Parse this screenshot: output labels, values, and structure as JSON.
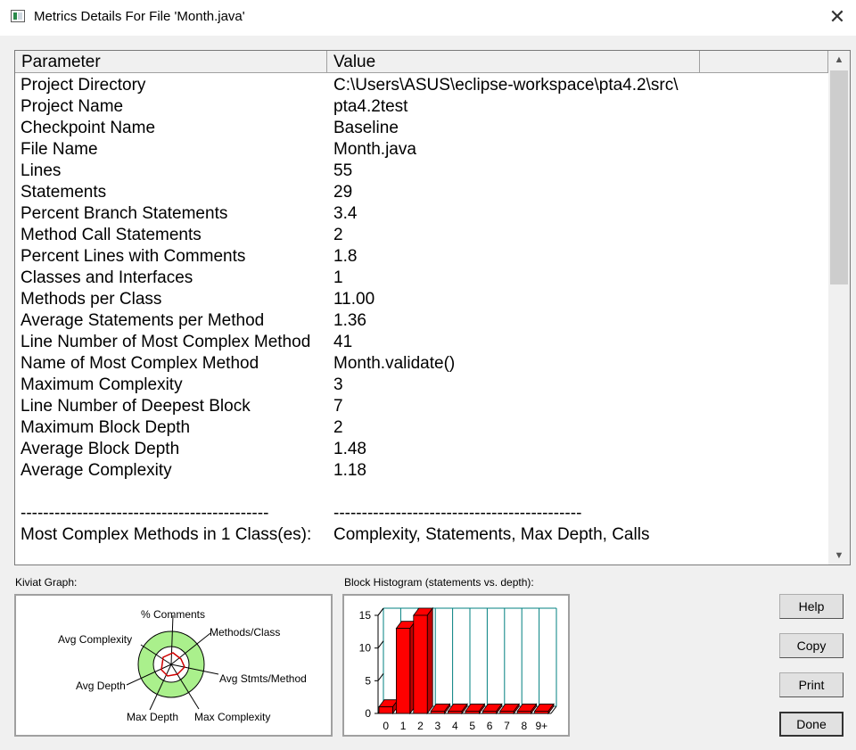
{
  "window": {
    "title": "Metrics Details For File 'Month.java'",
    "close_label": "✕"
  },
  "table": {
    "headers": [
      "Parameter",
      "Value"
    ],
    "rows": [
      {
        "p": "Project Directory",
        "v": "C:\\Users\\ASUS\\eclipse-workspace\\pta4.2\\src\\"
      },
      {
        "p": "Project Name",
        "v": "pta4.2test"
      },
      {
        "p": "Checkpoint Name",
        "v": "Baseline"
      },
      {
        "p": "File Name",
        "v": "Month.java"
      },
      {
        "p": "Lines",
        "v": "55"
      },
      {
        "p": "Statements",
        "v": "29"
      },
      {
        "p": "Percent Branch Statements",
        "v": "3.4"
      },
      {
        "p": "Method Call Statements",
        "v": "2"
      },
      {
        "p": "Percent Lines with Comments",
        "v": "1.8"
      },
      {
        "p": "Classes and Interfaces",
        "v": "1"
      },
      {
        "p": "Methods per Class",
        "v": "11.00"
      },
      {
        "p": "Average Statements per Method",
        "v": "1.36"
      },
      {
        "p": "Line Number of Most Complex Method",
        "v": "41"
      },
      {
        "p": "Name of Most Complex Method",
        "v": "Month.validate()"
      },
      {
        "p": "Maximum Complexity",
        "v": "3"
      },
      {
        "p": "Line Number of Deepest Block",
        "v": "7"
      },
      {
        "p": "Maximum Block Depth",
        "v": "2"
      },
      {
        "p": "Average Block Depth",
        "v": "1.48"
      },
      {
        "p": "Average Complexity",
        "v": "1.18"
      },
      {
        "p": "",
        "v": ""
      },
      {
        "p": "--------------------------------------------",
        "v": "--------------------------------------------"
      },
      {
        "p": "Most Complex Methods in 1 Class(es):",
        "v": "Complexity, Statements, Max Depth, Calls"
      }
    ]
  },
  "kiviat": {
    "label": "Kiviat Graph:",
    "axes": [
      "% Comments",
      "Methods/Class",
      "Avg Stmts/Method",
      "Max Complexity",
      "Max Depth",
      "Avg Depth",
      "Avg Complexity"
    ]
  },
  "histogram": {
    "label": "Block Histogram (statements vs. depth):",
    "y_ticks": [
      "15",
      "10",
      "5",
      "0"
    ],
    "categories": [
      "0",
      "1",
      "2",
      "3",
      "4",
      "5",
      "6",
      "7",
      "8",
      "9+"
    ],
    "values": [
      1,
      13,
      15,
      0,
      0,
      0,
      0,
      0,
      0,
      0
    ],
    "ylim": [
      0,
      15
    ],
    "bar_color": "#ff0000",
    "grid_color": "#008080"
  },
  "buttons": {
    "help": "Help",
    "copy": "Copy",
    "print": "Print",
    "done": "Done"
  }
}
